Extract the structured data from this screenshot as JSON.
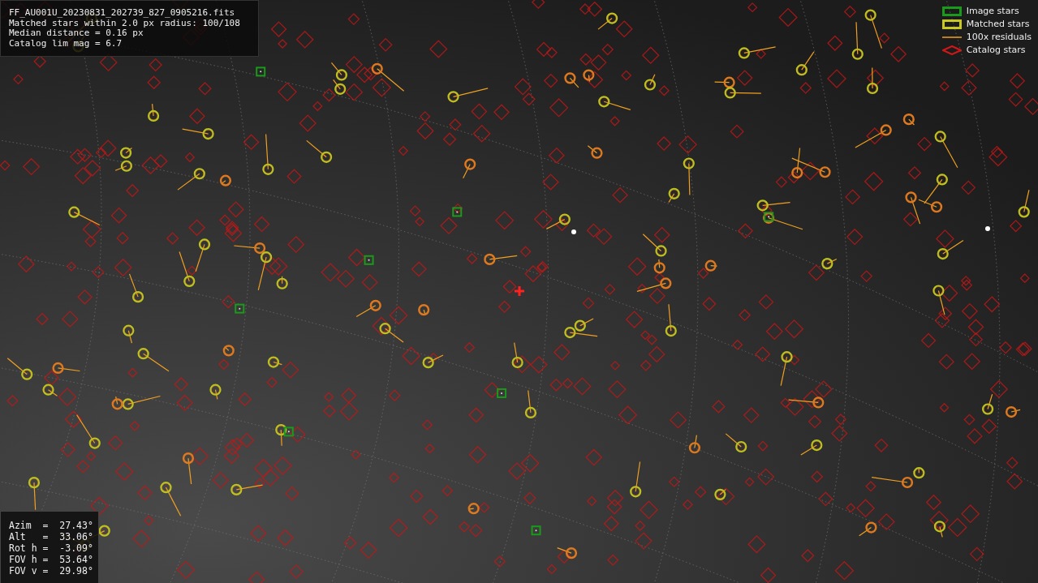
{
  "info": {
    "lines": [
      "FF_AU001U_20230831_202739_827_0905216.fits",
      "Matched stars within 2.0 px radius: 100/108",
      "Median distance = 0.16 px",
      "Catalog lim mag = 6.7"
    ]
  },
  "legend": [
    {
      "kind": "image",
      "label": "Image stars"
    },
    {
      "kind": "matched",
      "label": "Matched stars"
    },
    {
      "kind": "residual",
      "label": "100x residuals"
    },
    {
      "kind": "catalog",
      "label": "Catalog stars"
    }
  ],
  "pointing": {
    "lines": [
      "Azim  =  27.43°",
      "Alt   =  33.06°",
      "Rot h =  -3.09°",
      "FOV h =  53.64°",
      "FOV v =  29.98°"
    ]
  }
}
